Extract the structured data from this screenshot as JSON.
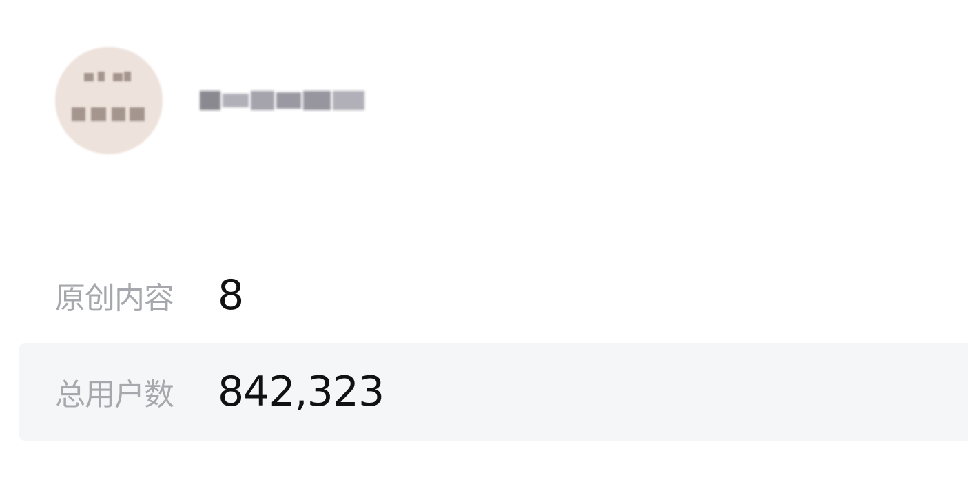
{
  "account": {
    "avatar_text": "",
    "name": ""
  },
  "stats": [
    {
      "label": "原创内容",
      "value": "8"
    },
    {
      "label": "总用户数",
      "value": "842,323"
    }
  ],
  "colors": {
    "label": "#a6a8ad",
    "value": "#111111",
    "row_highlight": "#f5f6f8",
    "avatar_bg": "#eee2dc"
  }
}
